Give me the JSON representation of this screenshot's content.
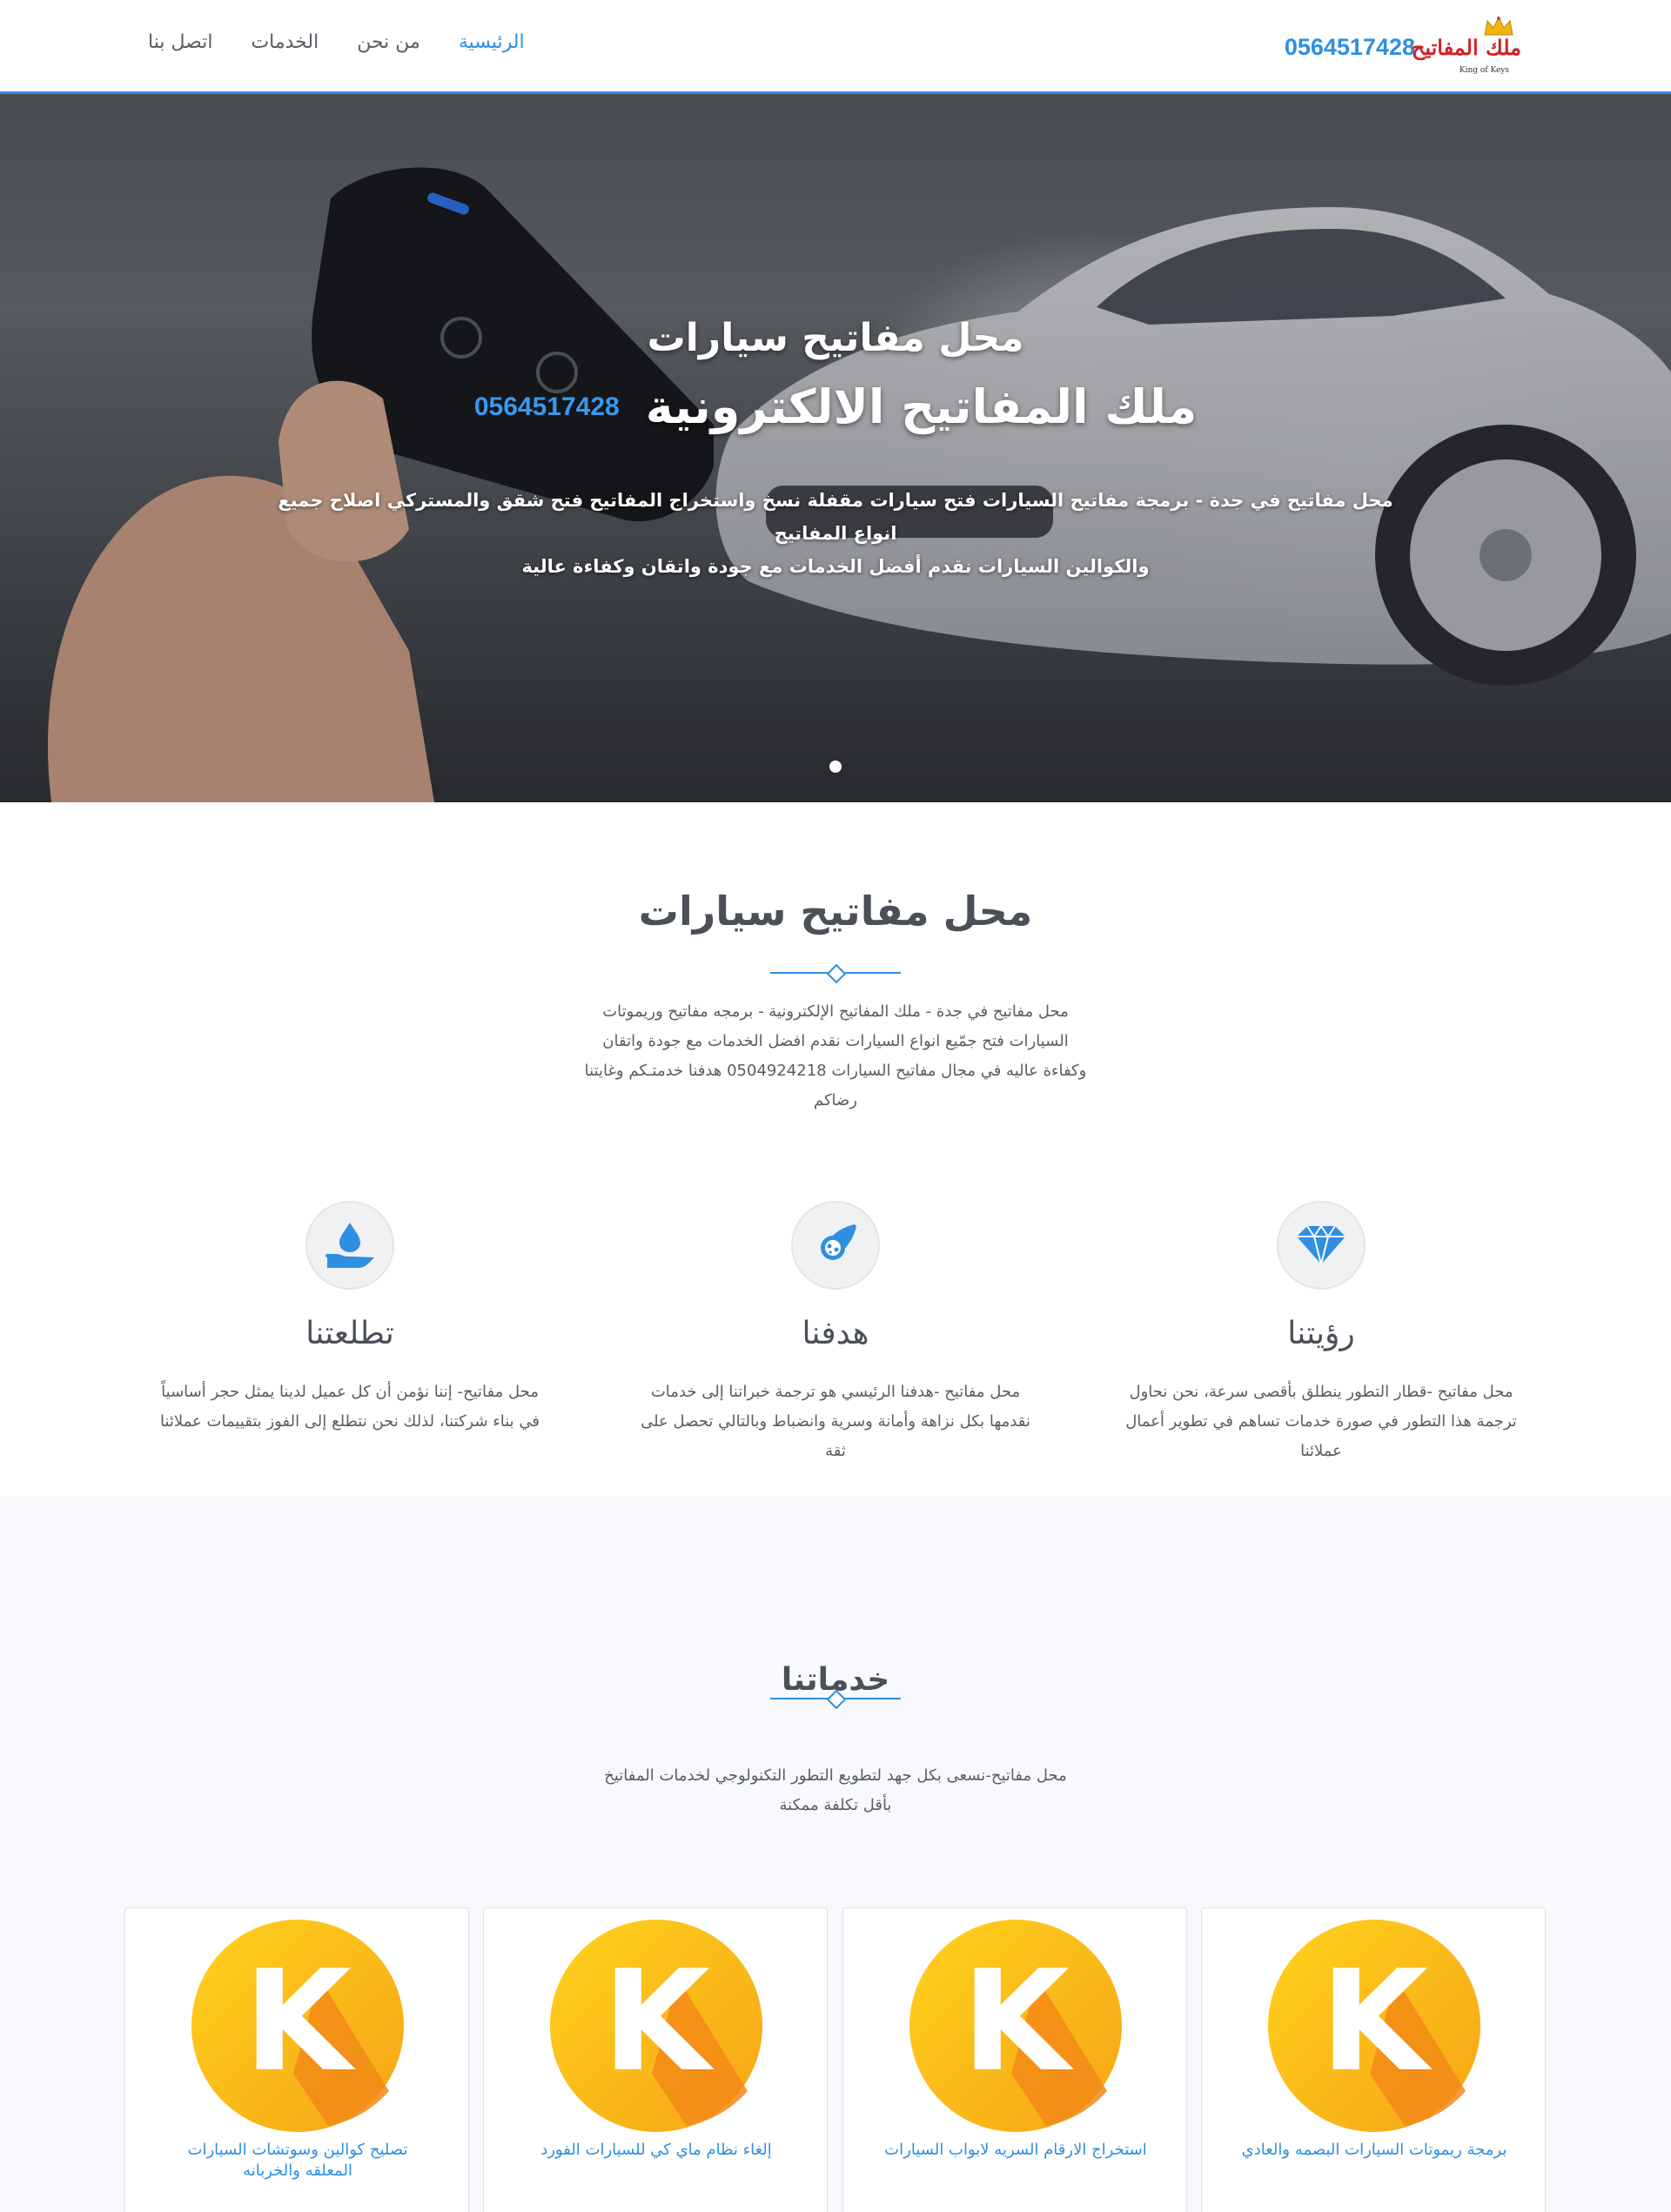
{
  "header": {
    "logo_text": "ملك المفاتيح",
    "logo_subtext": "King of Keys",
    "phone": "0564517428",
    "nav": [
      {
        "label": "الرئيسية",
        "active": true
      },
      {
        "label": "من نحن",
        "active": false
      },
      {
        "label": "الخدمات",
        "active": false
      },
      {
        "label": "اتصل بنا",
        "active": false
      }
    ]
  },
  "hero": {
    "title": "محل مفاتيح سيارات",
    "subtitle": "ملك المفاتيح الالكترونية",
    "phone": "0564517428",
    "description_line1": "محل مفاتيح في جدة - برمجة مفاتيح السيارات فتح سيارات مقفلة نسخ واستخراج المفاتيح فتح شقق والمستركي اصلاح جميع انواع المفاتيح",
    "description_line2": "والكوالين السيارات نقدم أفضل الخدمات مع جودة واتقان وكفاءة عالية"
  },
  "about": {
    "title": "محل مفاتيح سيارات",
    "text_lines": [
      "محل مفاتيح في جدة - ملك المفاتيح الإلكترونية - برمجه مفاتيح وريموتات",
      "السيارات فتح جمّيع انواع السيارات نقدم افضل الخدمات مع جودة واتقان",
      "وكفاءة عاليه في مجال مفاتيح السيارات 0504924218 هدفنا خدمتـكم وغايتنا",
      "رضاكم"
    ]
  },
  "features": [
    {
      "icon": "diamond-icon",
      "title": "رؤيتنا",
      "lines": [
        "محل مفاتيح -قطار التطور ينطلق بأقصى سرعة، نحن نحاول",
        "ترجمة هذا التطور في صورة خدمات تساهم في تطوير أعمال",
        "عملائنا"
      ]
    },
    {
      "icon": "rocket-icon",
      "title": "هدفنا",
      "lines": [
        "محل مفاتيح -هدفنا الرئيسي هو ترجمة خبراتنا إلى خدمات",
        "نقدمها بكل نزاهة وأمانة وسرية وانضباط وبالتالي تحصل على",
        "ثقة"
      ]
    },
    {
      "icon": "water-drop-hand-icon",
      "title": "تطلعتنا",
      "lines": [
        "محل مفاتيح- إننا نؤمن أن كل عميل لدينا يمثل حجر أساسياً",
        "في بناء شركتنا، لذلك نحن نتطلع إلى الفوز بتقييمات عملائنا"
      ]
    }
  ],
  "services": {
    "title": "خدماتنا",
    "text_lines": [
      "محل مفاتيح-نسعى بكل جهد لتطويع التطور التكنولوجي لخدمات المفاتيخ",
      "بأقل تكلفة ممكنة"
    ],
    "logo_letter": "K",
    "cards": [
      {
        "label_lines": [
          "برمجة ريموتات السيارات البصمه والعادي"
        ]
      },
      {
        "label_lines": [
          "استخراج الارقام السريه لابواب السيارات"
        ]
      },
      {
        "label_lines": [
          "إلغاء نظام ماي كي للسيارات الفورد"
        ]
      },
      {
        "label_lines": [
          "تصليح كوالين وسوتشات السيارات",
          "المعلقه والخربانه"
        ]
      }
    ]
  },
  "colors": {
    "accent": "#2f8fe0",
    "logo_red": "#d4202a",
    "k_yellow": "#f9c21a",
    "k_orange": "#f28a16"
  }
}
